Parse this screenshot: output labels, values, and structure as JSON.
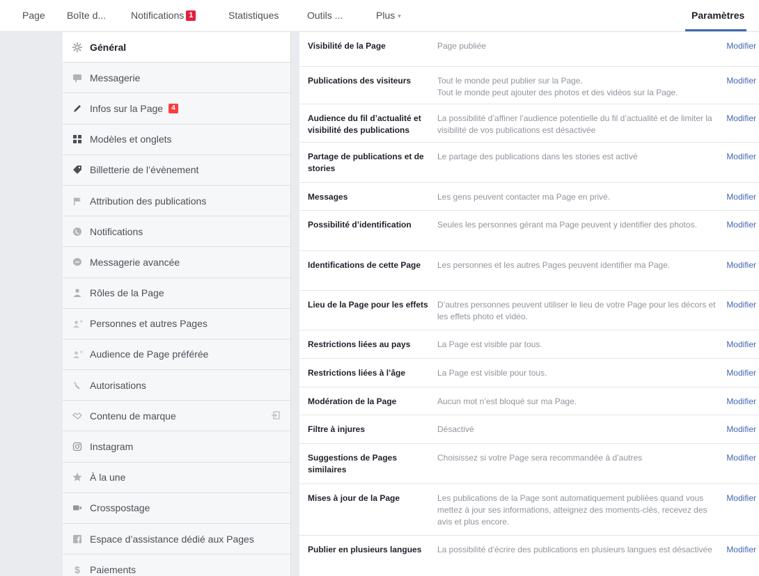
{
  "nav": {
    "items": [
      {
        "label": "Page"
      },
      {
        "label": "Boîte d..."
      },
      {
        "label": "Notifications",
        "badge": "1"
      },
      {
        "label": "Statistiques"
      },
      {
        "label": "Outils ..."
      },
      {
        "label": "Plus"
      }
    ],
    "active": {
      "label": "Paramètres"
    },
    "accent_color": "#4267b2",
    "badge_color": "#e41e3f"
  },
  "sidebar": {
    "items": [
      {
        "label": "Général",
        "icon": "gear-icon",
        "active": true
      },
      {
        "label": "Messagerie",
        "icon": "chat-bubble-icon"
      },
      {
        "label": "Infos sur la Page",
        "icon": "pencil-icon",
        "badge": "4"
      },
      {
        "label": "Modèles et onglets",
        "icon": "grid-icon"
      },
      {
        "label": "Billetterie de l’évènement",
        "icon": "ticket-tag-icon"
      },
      {
        "label": "Attribution des publications",
        "icon": "flag-icon"
      },
      {
        "label": "Notifications",
        "icon": "globe-icon"
      },
      {
        "label": "Messagerie avancée",
        "icon": "messenger-icon"
      },
      {
        "label": "Rôles de la Page",
        "icon": "person-icon"
      },
      {
        "label": "Personnes et autres Pages",
        "icon": "person-star-icon"
      },
      {
        "label": "Audience de Page préférée",
        "icon": "person-star-icon"
      },
      {
        "label": "Autorisations",
        "icon": "wrench-icon"
      },
      {
        "label": "Contenu de marque",
        "icon": "handshake-icon",
        "right_icon": "export-icon"
      },
      {
        "label": "Instagram",
        "icon": "instagram-icon"
      },
      {
        "label": "À la une",
        "icon": "star-icon"
      },
      {
        "label": "Crosspostage",
        "icon": "video-camera-icon"
      },
      {
        "label": "Espace d’assistance dédié aux Pages",
        "icon": "facebook-icon"
      },
      {
        "label": "Paiements",
        "icon": "dollar-icon"
      }
    ]
  },
  "settings": {
    "edit_label": "Modifier",
    "rows": [
      {
        "label": "Visibilité de la Page",
        "value": "Page publiée"
      },
      {
        "label": "Publications des visiteurs",
        "value": "Tout le monde peut publier sur la Page.\nTout le monde peut ajouter des photos et des vidéos sur la Page."
      },
      {
        "label": "Audience du fil d’actualité et visibilité des publications",
        "value": "La possibilité d’affiner l’audience potentielle du fil d’actualité et de limiter la visibilité de vos publications est désactivée"
      },
      {
        "label": "Partage de publications et de stories",
        "value": "Le partage des publications dans les stories est activé"
      },
      {
        "label": "Messages",
        "value": "Les gens peuvent contacter ma Page en privé."
      },
      {
        "label": "Possibilité d’identification",
        "value": "Seules les personnes gérant ma Page peuvent y identifier des photos."
      },
      {
        "label": "Identifications de cette Page",
        "value": "Les personnes et les autres Pages peuvent identifier ma Page."
      },
      {
        "label": "Lieu de la Page pour les effets",
        "value": "D’autres personnes peuvent utiliser le lieu de votre Page pour les décors et les effets photo et vidéo."
      },
      {
        "label": "Restrictions liées au pays",
        "value": "La Page est visible par tous."
      },
      {
        "label": "Restrictions liées à l’âge",
        "value": "La Page est visible pour tous."
      },
      {
        "label": "Modération de la Page",
        "value": "Aucun mot n’est bloqué sur ma Page."
      },
      {
        "label": "Filtre à injures",
        "value": "Désactivé"
      },
      {
        "label": "Suggestions de Pages similaires",
        "value": "Choisissez si votre Page sera recommandée à d’autres"
      },
      {
        "label": "Mises à jour de la Page",
        "value": "Les publications de la Page sont automatiquement publiées quand vous mettez à jour ses informations, atteignez des moments-clés, recevez des avis et plus encore."
      },
      {
        "label": "Publier en plusieurs langues",
        "value": "La possibilité d’écrire des publications en plusieurs langues est désactivée"
      }
    ]
  }
}
